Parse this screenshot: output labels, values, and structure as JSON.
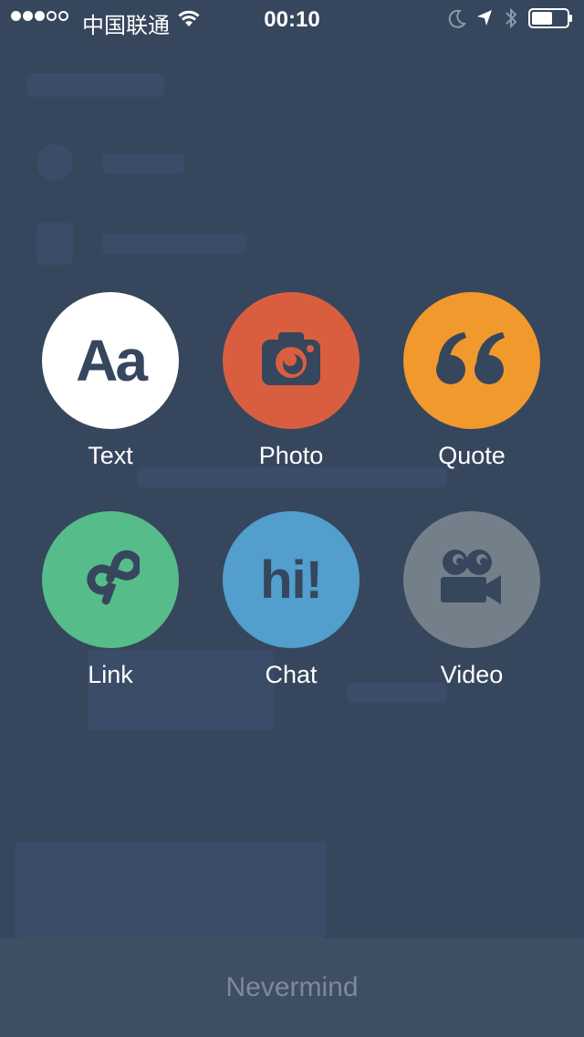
{
  "status_bar": {
    "carrier": "中国联通",
    "time": "00:10",
    "signal_bars_filled": 3,
    "signal_bars_total": 5,
    "battery_level": 0.6
  },
  "post_types": [
    {
      "id": "text",
      "label": "Text",
      "glyph": "Aa",
      "color": "#ffffff",
      "icon": "text-icon"
    },
    {
      "id": "photo",
      "label": "Photo",
      "color": "#d95e40",
      "icon": "camera-icon"
    },
    {
      "id": "quote",
      "label": "Quote",
      "color": "#f2992e",
      "icon": "quote-icon"
    },
    {
      "id": "link",
      "label": "Link",
      "color": "#56bc8a",
      "icon": "link-icon"
    },
    {
      "id": "chat",
      "label": "Chat",
      "glyph": "hi!",
      "color": "#529ecc",
      "icon": "chat-icon"
    },
    {
      "id": "video",
      "label": "Video",
      "color": "#748089",
      "icon": "video-camera-icon"
    }
  ],
  "cancel": {
    "label": "Nevermind"
  },
  "colors": {
    "background": "#36465d",
    "icon_dark": "#36465d",
    "cancel_bar": "#3f4f63",
    "cancel_text": "#7d8a9c"
  }
}
